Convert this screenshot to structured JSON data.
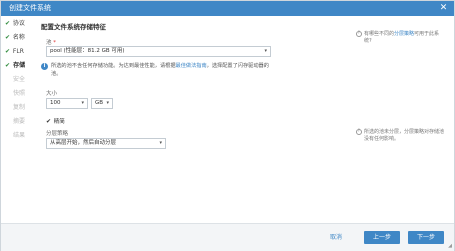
{
  "window": {
    "title": "创建文件系统",
    "close_glyph": "✕"
  },
  "steps": [
    {
      "label": "协议",
      "state": "done"
    },
    {
      "label": "名称",
      "state": "done"
    },
    {
      "label": "FLR",
      "state": "done"
    },
    {
      "label": "存储",
      "state": "active"
    },
    {
      "label": "安全",
      "state": "pending"
    },
    {
      "label": "快照",
      "state": "pending"
    },
    {
      "label": "复制",
      "state": "pending"
    },
    {
      "label": "摘要",
      "state": "pending"
    },
    {
      "label": "结果",
      "state": "pending"
    }
  ],
  "check_glyph": "✔",
  "form": {
    "heading": "配置文件系统存储特征",
    "pool_label": "池",
    "pool_required": "*",
    "pool_value": "pool (性能层：81.2 GB 可用)",
    "info_text_before": "所选的池不含任何存储功能。为达到最佳性能，请根据",
    "info_link": "最佳做法指南",
    "info_text_after": "，选择配置了闪存驱动器的池。",
    "info_icon": "i",
    "size_label": "大小",
    "size_value": "100",
    "size_unit": "GB",
    "thin_label": "精简",
    "thin_checked": true,
    "policy_label": "分层策略",
    "policy_value": "从高层开始，然后自动分层",
    "arrow_glyph": "▾"
  },
  "right_info": [
    {
      "text_before": "有哪些不同的",
      "link": "分层策略",
      "text_after": "可用于此系统?"
    },
    {
      "text_before": "所选的池未分层，分层策略对存储池没有任何影响。",
      "link": "",
      "text_after": ""
    }
  ],
  "right_icon": "?",
  "footer": {
    "cancel": "取消",
    "prev": "上一步",
    "next": "下一步"
  }
}
